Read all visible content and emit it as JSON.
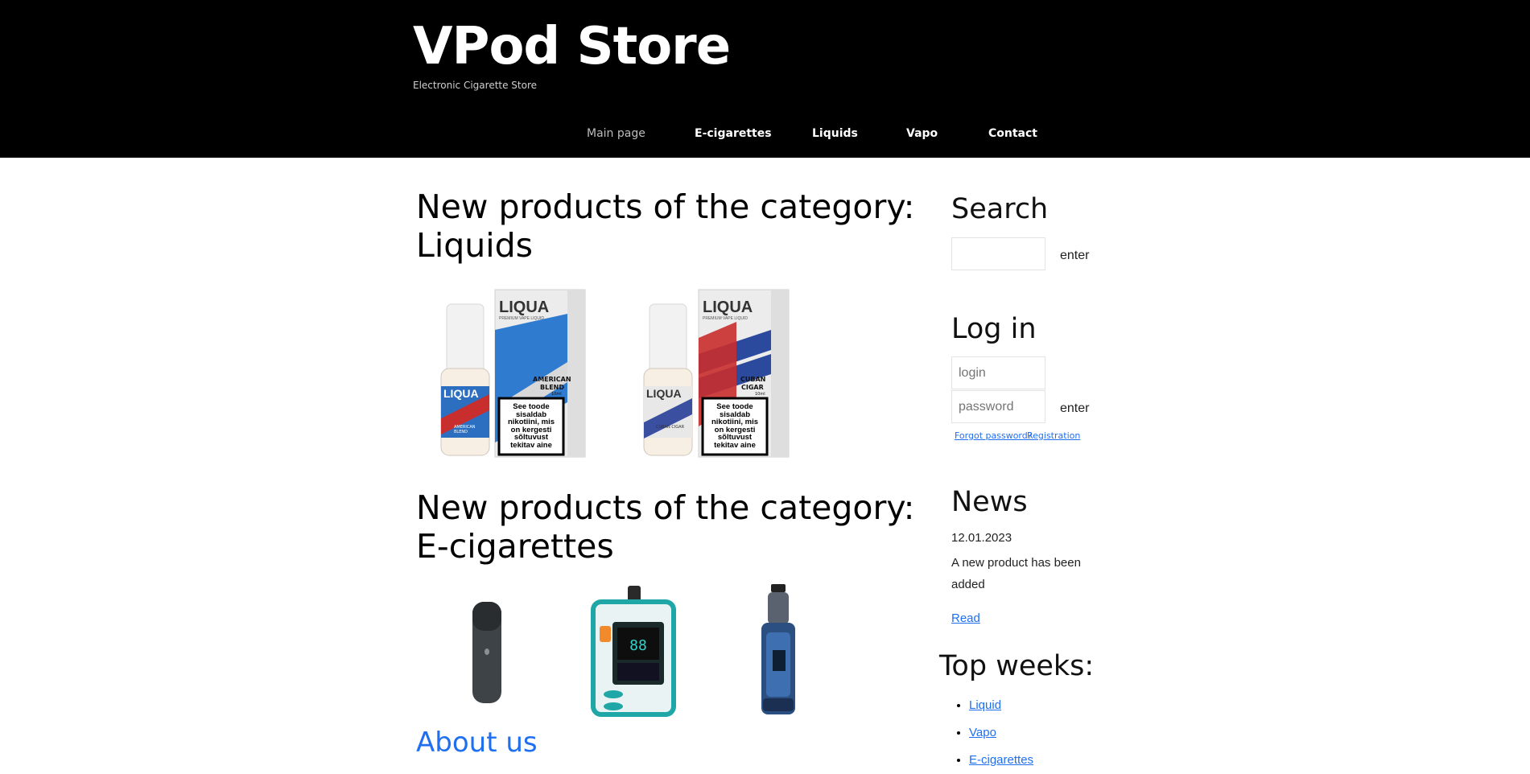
{
  "brand": {
    "title": "VPod Store",
    "tagline": "Electronic Cigarette Store"
  },
  "nav": [
    {
      "label": "Main page",
      "active": true
    },
    {
      "label": "E-cigarettes"
    },
    {
      "label": "Liquids"
    },
    {
      "label": "Vapo"
    },
    {
      "label": "Contact"
    }
  ],
  "main": {
    "section1": {
      "title_line1": "New products of the category:",
      "title_line2": "Liquids"
    },
    "liquids": [
      {
        "brand": "LIQUA",
        "sub": "PREMIUM VAPE LIQUID",
        "flavor_line1": "AMERICAN",
        "flavor_line2": "BLEND",
        "warning_lines": [
          "See toode",
          "sisaldab",
          "nikotiini, mis",
          "on kergesti",
          "sõltuvust",
          "tekitav aine"
        ],
        "size": "10ml",
        "label_bottle": "AMERICAN BLEND"
      },
      {
        "brand": "LIQUA",
        "sub": "PREMIUM VAPE LIQUID",
        "flavor_line1": "CUBAN",
        "flavor_line2": "CIGAR",
        "warning_lines": [
          "See toode",
          "sisaldab",
          "nikotiini, mis",
          "on kergesti",
          "sõltuvust",
          "tekitav aine"
        ],
        "size": "10ml",
        "label_bottle": "CUBAN CIGAR"
      }
    ],
    "section2": {
      "title_line1": "New products of the category:",
      "title_line2": "E-cigarettes"
    },
    "about": "About us"
  },
  "sidebar": {
    "search": {
      "title": "Search",
      "placeholder": "",
      "enter": "enter"
    },
    "login": {
      "title": "Log in",
      "login_placeholder": "login",
      "password_placeholder": "password",
      "enter": "enter",
      "forgot": "Forgot password?",
      "register": "Registration"
    },
    "news": {
      "title": "News",
      "date": "12.01.2023",
      "text_line1": "A new product has been",
      "text_line2": "added",
      "read": "Read"
    },
    "top": {
      "title": "Top weeks:",
      "items": [
        "Liquid",
        "Vapo",
        "E-cigarettes"
      ]
    }
  },
  "colors": {
    "header_bg": "#000000",
    "link": "#1f6ff0"
  }
}
